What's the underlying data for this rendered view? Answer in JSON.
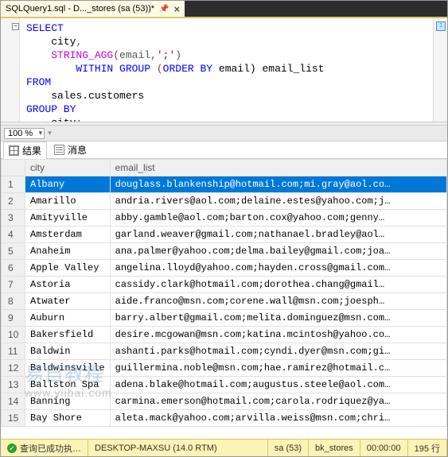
{
  "tab": {
    "title": "SQLQuery1.sql - D..._stores (sa (53))*"
  },
  "sql": {
    "select": "SELECT",
    "col1": "city",
    "fn": "STRING_AGG",
    "fn_args_open": "(email",
    "fn_sep": "';'",
    "fn_close": ")",
    "within": "WITHIN GROUP",
    "orderby": "ORDER BY",
    "orderby_col": " email)",
    "alias": " email_list",
    "from": "FROM",
    "table": "sales.customers",
    "groupby": "GROUP BY",
    "groupby_col": "city"
  },
  "zoom": "100 %",
  "results_tabs": {
    "results": "结果",
    "messages": "消息"
  },
  "columns": {
    "city": "city",
    "email_list": "email_list"
  },
  "rows": [
    {
      "n": "1",
      "city": "Albany",
      "email": "douglass.blankenship@hotmail.com;mi.gray@aol.co…",
      "sel": true
    },
    {
      "n": "2",
      "city": "Amarillo",
      "email": "andria.rivers@aol.com;delaine.estes@yahoo.com;j…"
    },
    {
      "n": "3",
      "city": "Amityville",
      "email": "abby.gamble@aol.com;barton.cox@yahoo.com;genny…"
    },
    {
      "n": "4",
      "city": "Amsterdam",
      "email": "garland.weaver@gmail.com;nathanael.bradley@aol…"
    },
    {
      "n": "5",
      "city": "Anaheim",
      "email": "ana.palmer@yahoo.com;delma.bailey@gmail.com;joa…"
    },
    {
      "n": "6",
      "city": "Apple Valley",
      "email": "angelina.lloyd@yahoo.com;hayden.cross@gmail.com…"
    },
    {
      "n": "7",
      "city": "Astoria",
      "email": "cassidy.clark@hotmail.com;dorothea.chang@gmail…"
    },
    {
      "n": "8",
      "city": "Atwater",
      "email": "aide.franco@msn.com;corene.wall@msn.com;joesph…"
    },
    {
      "n": "9",
      "city": "Auburn",
      "email": "barry.albert@gmail.com;melita.dominguez@msn.com…"
    },
    {
      "n": "10",
      "city": "Bakersfield",
      "email": "desire.mcgowan@msn.com;katina.mcintosh@yahoo.co…"
    },
    {
      "n": "11",
      "city": "Baldwin",
      "email": "ashanti.parks@hotmail.com;cyndi.dyer@msn.com;gi…"
    },
    {
      "n": "12",
      "city": "Baldwinsville",
      "email": "guillermina.noble@msn.com;hae.ramirez@hotmail.c…"
    },
    {
      "n": "13",
      "city": "Ballston Spa",
      "email": "adena.blake@hotmail.com;augustus.steele@aol.com…"
    },
    {
      "n": "14",
      "city": "Banning",
      "email": "carmina.emerson@hotmail.com;carola.rodriquez@ya…"
    },
    {
      "n": "15",
      "city": "Bay Shore",
      "email": "aleta.mack@yahoo.com;arvilla.weiss@msn.com;chri…"
    }
  ],
  "status": {
    "msg": "查询已成功执…",
    "server": "DESKTOP-MAXSU (14.0 RTM)",
    "login": "sa (53)",
    "db": "bk_stores",
    "time": "00:00:00",
    "rows": "195 行"
  },
  "watermark": {
    "main": "易自教程",
    "url": "www.yiibai.com"
  }
}
